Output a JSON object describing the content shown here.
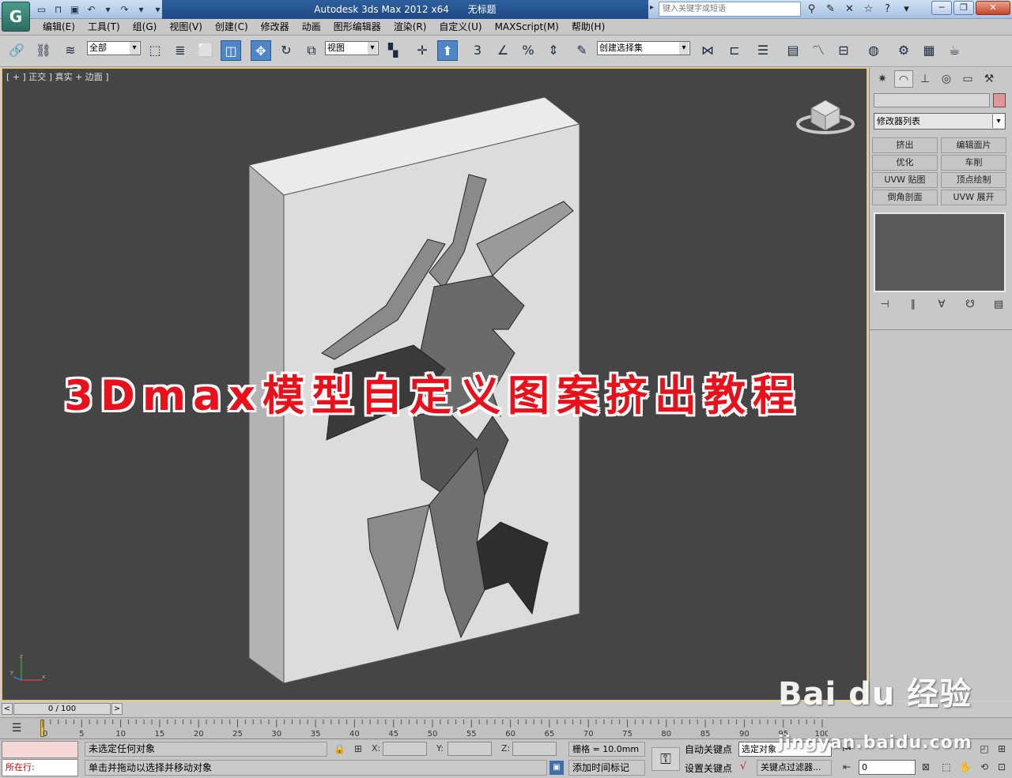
{
  "title_bar": {
    "app_name": "Autodesk 3ds Max  2012 x64",
    "doc_name": "无标题",
    "search_placeholder": "键入关键字或短语",
    "app_logo_icon": "3dsmax-logo-icon"
  },
  "menu": [
    "编辑(E)",
    "工具(T)",
    "组(G)",
    "视图(V)",
    "创建(C)",
    "修改器",
    "动画",
    "图形编辑器",
    "渲染(R)",
    "自定义(U)",
    "MAXScript(M)",
    "帮助(H)"
  ],
  "toolbar": {
    "selection_filter": "全部",
    "ref_coord": "视图",
    "named_selection": "创建选择集",
    "snap_3": "3"
  },
  "viewport": {
    "label": "[ + ] 正交 ] 真实 + 边面 ]",
    "overlay_title": "3Dmax模型自定义图案挤出教程",
    "accent": "#f0c040",
    "bg": "#454545"
  },
  "command_panel": {
    "modifier_list": "修改器列表",
    "object_color": "#e39696",
    "buttons": [
      "挤出",
      "编辑面片",
      "优化",
      "车削",
      "UVW 贴图",
      "顶点绘制",
      "倒角剖面",
      "UVW 展开"
    ]
  },
  "timeline": {
    "position": "0 / 100",
    "ticks": [
      "0",
      "5",
      "10",
      "15",
      "20",
      "25",
      "30",
      "35",
      "40",
      "45",
      "50",
      "55",
      "60",
      "65",
      "70",
      "75",
      "80",
      "85",
      "90",
      "95",
      "100"
    ]
  },
  "status": {
    "location_label": "所在行:",
    "selection": "未选定任何对象",
    "prompt": "单击并拖动以选择并移动对象",
    "x_label": "X:",
    "y_label": "Y:",
    "z_label": "Z:",
    "grid": "栅格 = 10.0mm",
    "add_time_tag": "添加时间标记",
    "auto_key": "自动关键点",
    "set_key": "设置关键点",
    "selected_object": "选定对象",
    "key_filters": "关键点过滤器...",
    "frame": "0"
  },
  "watermark": {
    "logo": "Bai du 经验",
    "url": "jingyan.baidu.com"
  }
}
